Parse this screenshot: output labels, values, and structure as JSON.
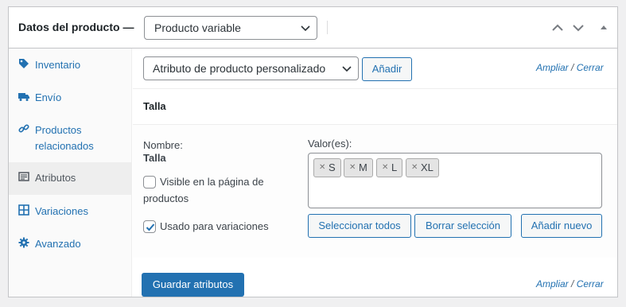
{
  "header": {
    "title": "Datos del producto —",
    "product_type": "Producto variable"
  },
  "sidebar": {
    "items": [
      {
        "label": "Inventario",
        "icon": "tag-icon"
      },
      {
        "label": "Envío",
        "icon": "truck-icon"
      },
      {
        "label": "Productos relacionados",
        "icon": "link-icon"
      },
      {
        "label": "Atributos",
        "icon": "list-icon",
        "active": true
      },
      {
        "label": "Variaciones",
        "icon": "grid-icon"
      },
      {
        "label": "Avanzado",
        "icon": "gear-icon"
      }
    ]
  },
  "toolbar": {
    "attribute_select": "Atributo de producto personalizado",
    "add_button": "Añadir",
    "expand_link": "Ampliar",
    "separator": "/",
    "close_link": "Cerrar"
  },
  "attribute": {
    "header_name": "Talla",
    "name_label": "Nombre:",
    "name_value": "Talla",
    "visible_label_line1": "Visible en la página de",
    "visible_label_line2": "productos",
    "visible_checked": false,
    "variations_label": "Usado para variaciones",
    "variations_checked": true,
    "values_label": "Valor(es):",
    "values": [
      "S",
      "M",
      "L",
      "XL"
    ],
    "select_all_button": "Seleccionar todos",
    "clear_button": "Borrar selección",
    "add_new_button": "Añadir nuevo"
  },
  "footer": {
    "save_button": "Guardar atributos",
    "expand_link": "Ampliar",
    "separator": "/",
    "close_link": "Cerrar"
  },
  "colors": {
    "link": "#2271b1",
    "primary": "#2271b1",
    "border": "#c3c4c7"
  }
}
